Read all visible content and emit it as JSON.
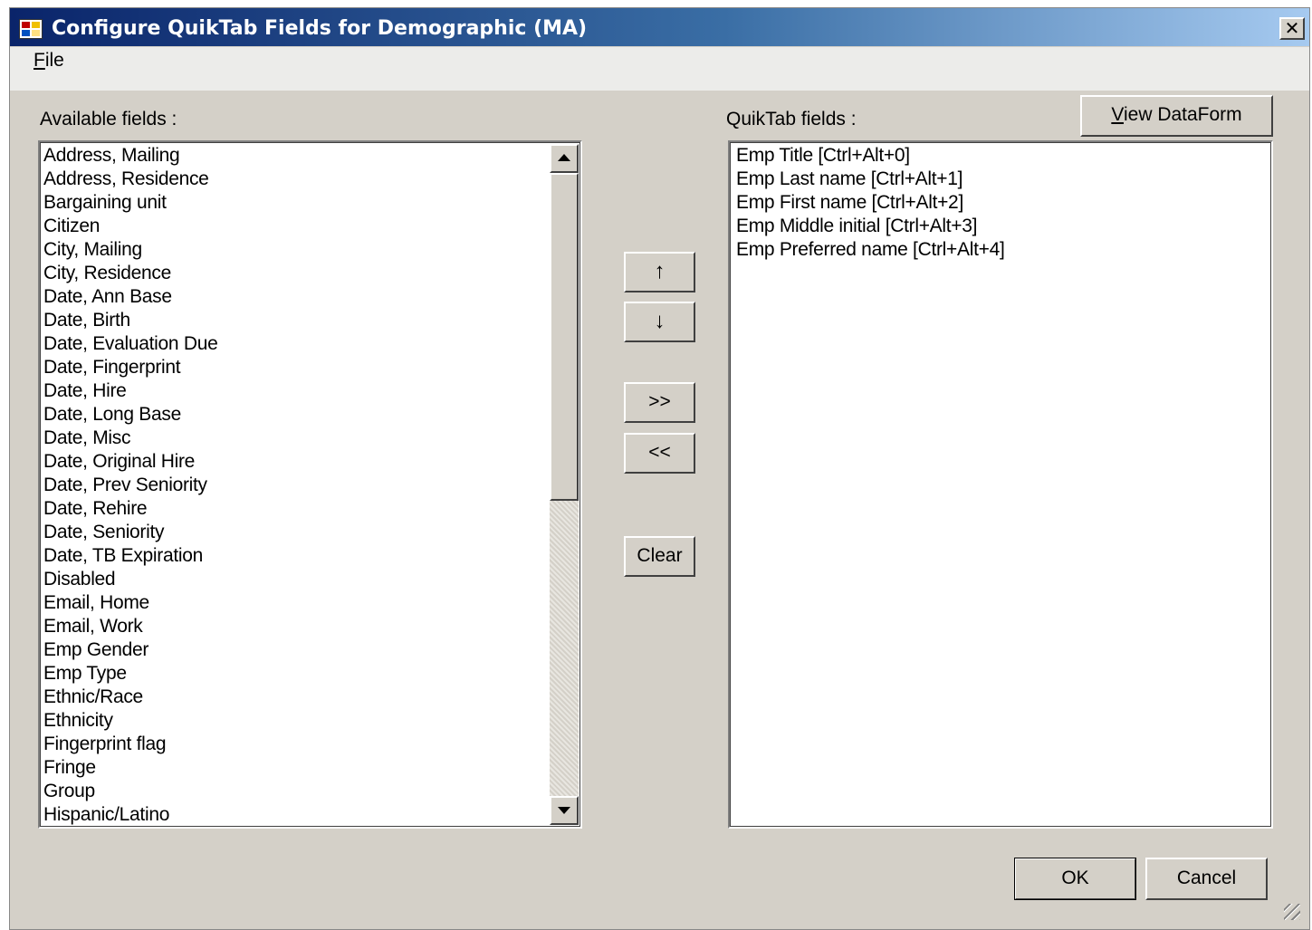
{
  "window": {
    "title": "Configure QuikTab Fields for Demographic (MA)",
    "close_label": "✕"
  },
  "menu": {
    "file_label": "File",
    "file_mnemonic": "F",
    "file_rest": "ile"
  },
  "available": {
    "label": "Available fields :",
    "items": [
      "Address, Mailing",
      "Address, Residence",
      "Bargaining unit",
      "Citizen",
      "City, Mailing",
      "City, Residence",
      "Date, Ann Base",
      "Date, Birth",
      "Date, Evaluation Due",
      "Date, Fingerprint",
      "Date, Hire",
      "Date, Long Base",
      "Date, Misc",
      "Date, Original Hire",
      "Date, Prev Seniority",
      "Date, Rehire",
      "Date, Seniority",
      "Date, TB Expiration",
      "Disabled",
      "Email, Home",
      "Email, Work",
      "Emp Gender",
      "Emp Type",
      "Ethnic/Race",
      "Ethnicity",
      "Fingerprint flag",
      "Fringe",
      "Group",
      "Hispanic/Latino"
    ]
  },
  "quiktab": {
    "label": "QuikTab fields :",
    "items": [
      "Emp Title [Ctrl+Alt+0]",
      "Emp Last name [Ctrl+Alt+1]",
      "Emp First name [Ctrl+Alt+2]",
      "Emp Middle initial [Ctrl+Alt+3]",
      "Emp Preferred name [Ctrl+Alt+4]"
    ]
  },
  "buttons": {
    "view_dataform_mnemonic": "V",
    "view_dataform_rest": "iew DataForm",
    "move_up": "↑",
    "move_down": "↓",
    "add": ">>",
    "remove": "<<",
    "clear": "Clear",
    "ok": "OK",
    "cancel": "Cancel"
  }
}
